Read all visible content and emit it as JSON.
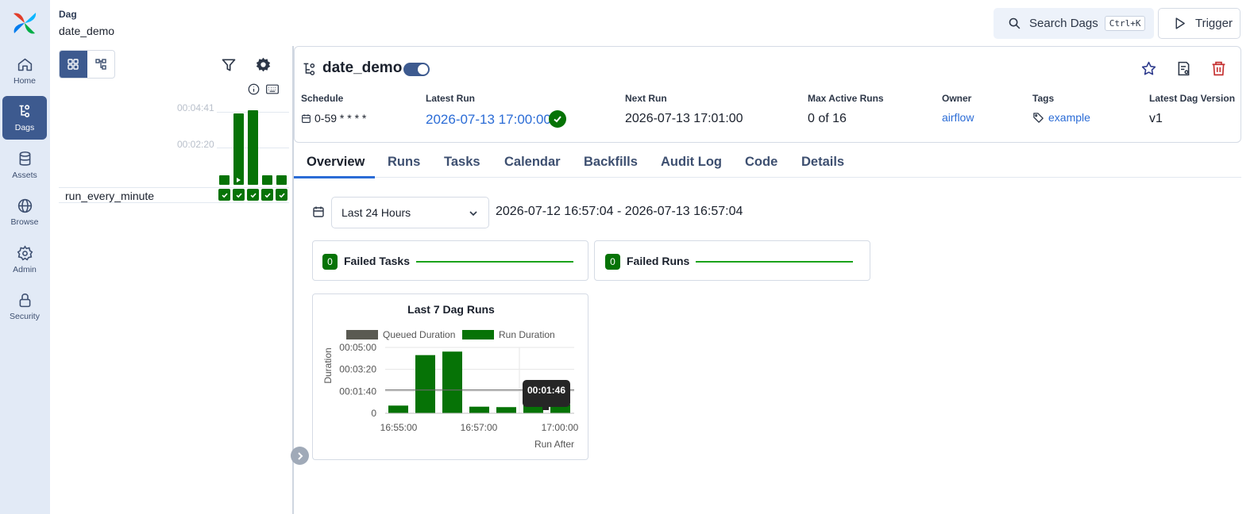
{
  "nav": {
    "items": [
      {
        "label": "Home",
        "icon": "home-icon"
      },
      {
        "label": "Dags",
        "icon": "dags-icon",
        "active": true
      },
      {
        "label": "Assets",
        "icon": "database-icon"
      },
      {
        "label": "Browse",
        "icon": "globe-icon"
      },
      {
        "label": "Admin",
        "icon": "gear-icon"
      },
      {
        "label": "Security",
        "icon": "lock-icon"
      }
    ]
  },
  "breadcrumb": {
    "type": "Dag",
    "name": "date_demo"
  },
  "topbar": {
    "search_label": "Search Dags",
    "search_shortcut": "Ctrl+K",
    "trigger_label": "Trigger"
  },
  "grid": {
    "duration_ticks": [
      "00:04:41",
      "00:02:20"
    ],
    "task_name": "run_every_minute",
    "run_durations_fraction": [
      0.12,
      1.0,
      1.04,
      0.12,
      0.12
    ],
    "run_states": [
      "success",
      "success",
      "success",
      "success",
      "success"
    ],
    "color_success": "#067306"
  },
  "dag": {
    "title": "date_demo",
    "paused": false,
    "schedule_label": "Schedule",
    "schedule_value": "0-59 * * * *",
    "latest_run_label": "Latest Run",
    "latest_run_value": "2026-07-13 17:00:00",
    "next_run_label": "Next Run",
    "next_run_value": "2026-07-13 17:01:00",
    "max_active_label": "Max Active Runs",
    "max_active_value": "0 of 16",
    "owner_label": "Owner",
    "owner_value": "airflow",
    "tags_label": "Tags",
    "tags_value": "example",
    "version_label": "Latest Dag Version",
    "version_value": "v1"
  },
  "tabs": [
    "Overview",
    "Runs",
    "Tasks",
    "Calendar",
    "Backfills",
    "Audit Log",
    "Code",
    "Details"
  ],
  "overview": {
    "range_select": "Last 24 Hours",
    "range_text": "2026-07-12 16:57:04 - 2026-07-13 16:57:04",
    "failed_tasks_count": "0",
    "failed_tasks_label": "Failed Tasks",
    "failed_runs_count": "0",
    "failed_runs_label": "Failed Runs"
  },
  "chart_data": {
    "type": "bar",
    "title": "Last 7 Dag Runs",
    "xlabel": "Run After",
    "ylabel": "Duration",
    "legend": [
      {
        "name": "Queued Duration",
        "color": "#5a5a52"
      },
      {
        "name": "Run Duration",
        "color": "#067306"
      }
    ],
    "legend_position": "top",
    "y_ticks": [
      "00:05:00",
      "00:03:20",
      "00:01:40",
      "0"
    ],
    "y_tick_seconds": [
      300,
      200,
      100,
      0
    ],
    "ylim": [
      0,
      300
    ],
    "x_ticks": [
      "16:55:00",
      "16:57:00",
      "17:00:00"
    ],
    "series": [
      {
        "name": "Queued Duration",
        "values": [
          0,
          0,
          0,
          0,
          0,
          0,
          0
        ]
      },
      {
        "name": "Run Duration",
        "values": [
          35,
          265,
          281,
          30,
          28,
          45,
          40
        ]
      }
    ],
    "reference_line_seconds": 106,
    "tooltip": "00:01:46",
    "grid": true
  }
}
